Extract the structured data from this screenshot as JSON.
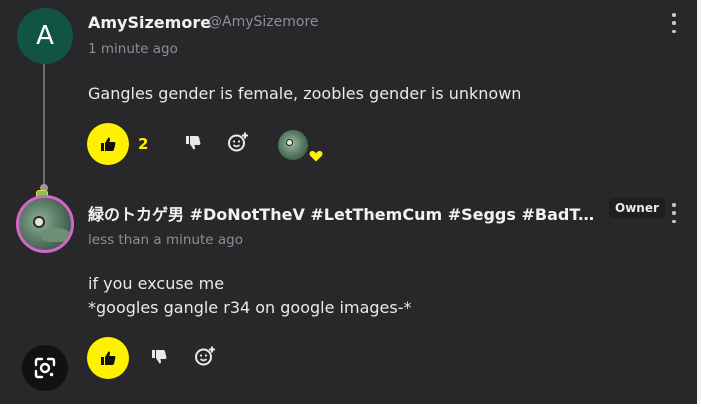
{
  "comments": [
    {
      "avatar_letter": "A",
      "username": "AmySizemore",
      "handle": "@AmySizemore",
      "time": "1 minute ago",
      "text": "Gangles gender is female, zoobles gender is unknown",
      "like_count": "2"
    },
    {
      "username": "緑のトカゲ男 #DoNotTheV #LetThemCum #Seggs #BadToTheBone",
      "badge": "Owner",
      "time": "less than a minute ago",
      "lines": [
        "if you excuse me",
        "*googles gangle r34 on google images-*"
      ]
    }
  ],
  "icons": {
    "more": "kebab-icon",
    "like": "thumbs-up-icon",
    "dislike": "thumbs-down-icon",
    "react": "add-reaction-icon",
    "lens": "google-lens-icon",
    "heart": "heart-icon"
  },
  "colors": {
    "background": "#28282b",
    "accent": "#fff200",
    "avatar_a": "#125443",
    "avatar_ring": "#d466c8"
  }
}
